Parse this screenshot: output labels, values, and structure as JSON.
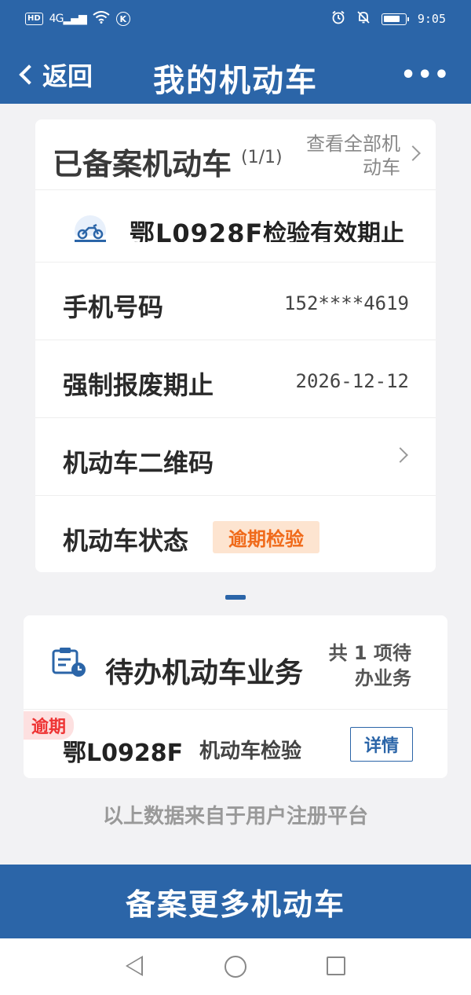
{
  "status_bar": {
    "hd": "HD",
    "network": "4G",
    "k_badge": "K",
    "time": "9:05",
    "icons": [
      "alarm-icon",
      "bell-off-icon",
      "battery-icon"
    ]
  },
  "nav": {
    "back_label": "返回",
    "title": "我的机动车",
    "more_label": "•••"
  },
  "vehicles_card": {
    "title": "已备案机动车",
    "count": "(1/1)",
    "view_all": "查看全部机动车",
    "vehicle_plate_partial": "鄂L0928F",
    "vehicle_inspection_partial": "检验有效期止",
    "rows": [
      {
        "label": "手机号码",
        "value": "152****4619"
      },
      {
        "label": "强制报废期止",
        "value": "2026-12-12"
      },
      {
        "label": "机动车二维码",
        "value": ""
      },
      {
        "label": "机动车状态",
        "badge": "逾期检验"
      }
    ]
  },
  "pending_card": {
    "title": "待办机动车业务",
    "count": "共 1 项待办业务",
    "overdue_tag": "逾期",
    "plate": "鄂L0928F",
    "service": "机动车检验",
    "detail_button": "详情"
  },
  "footer_note": "以上数据来自于用户注册平台",
  "bottom_button": "备案更多机动车",
  "colors": {
    "primary": "#2b65a8",
    "badge_orange_bg": "#fde4d0",
    "badge_orange_text": "#f06a1a",
    "overdue_bg": "#fde0e0",
    "overdue_text": "#e33333"
  }
}
